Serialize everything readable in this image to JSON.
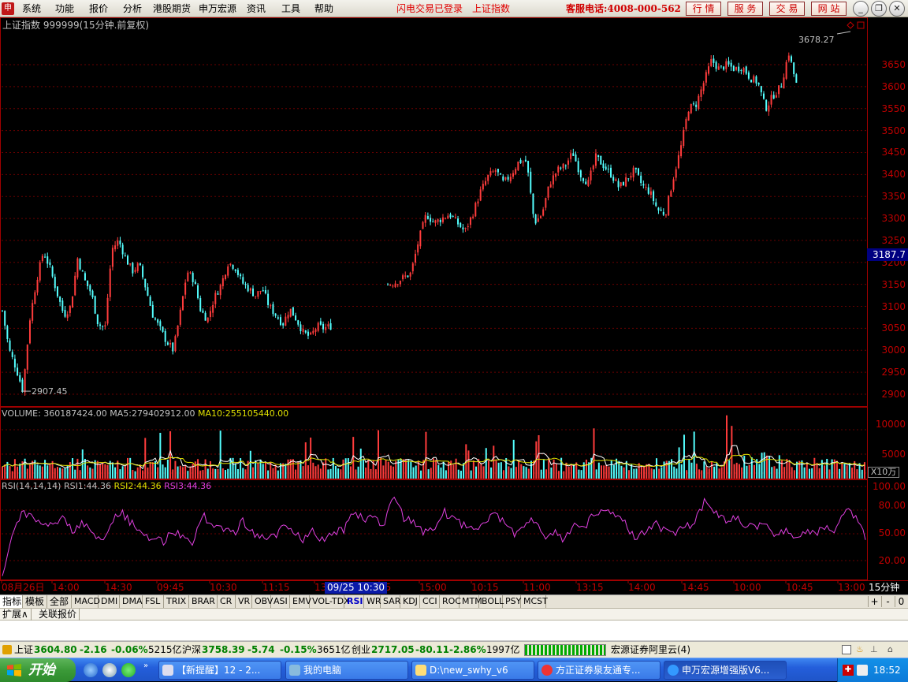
{
  "menu": {
    "items": [
      "系统",
      "功能",
      "报价",
      "分析",
      "港股期货",
      "申万宏源",
      "资讯",
      "工具",
      "帮助"
    ],
    "notice1": "闪电交易已登录",
    "notice2": "上证指数",
    "hotline": "客服电话:4008-000-562",
    "buttons": [
      "行 情",
      "服 务",
      "交 易",
      "网 站"
    ]
  },
  "price": {
    "title": "上证指数 999999(15分钟.前复权)",
    "y_ticks": [
      "3650",
      "3600",
      "3550",
      "3500",
      "3450",
      "3400",
      "3350",
      "3300",
      "3250",
      "3200",
      "3150",
      "3100",
      "3050",
      "3000",
      "2950",
      "2900"
    ],
    "high_label": "3678.27",
    "low_label": "2907.45",
    "current": "3187.7"
  },
  "volume": {
    "name": "VOLUME:",
    "value": "360187424.00",
    "ma5_label": "MA5:",
    "ma5": "279402912.00",
    "ma10_label": "MA10:",
    "ma10": "255105440.00",
    "y_ticks": [
      "10000",
      "5000"
    ],
    "multiplier": "X10万"
  },
  "rsi": {
    "name": "RSI(14,14,14)",
    "rsi1_label": "RSI1:",
    "rsi1": "44.36",
    "rsi2_label": "RSI2:",
    "rsi2": "44.36",
    "rsi3_label": "RSI3:",
    "rsi3": "44.36",
    "y_ticks": [
      "100.00",
      "80.00",
      "50.00",
      "20.00"
    ]
  },
  "xaxis": {
    "labels": [
      "08月26日",
      "14:00",
      "14:30",
      "09:45",
      "10:30",
      "11:15",
      "13",
      "15",
      "15:00",
      "10:15",
      "11:00",
      "13:15",
      "14:00",
      "14:45",
      "10:00",
      "10:45",
      "13:00"
    ],
    "cursor_date": "09/25 10:30",
    "period": "15分钟"
  },
  "tabs": [
    "指标",
    "模板",
    "全部",
    "MACD",
    "DMI",
    "DMA",
    "FSL",
    "TRIX",
    "BRAR",
    "CR",
    "VR",
    "OBV",
    "ASI",
    "EMV",
    "VOL-TDX",
    "RSI",
    "WR",
    "SAR",
    "KDJ",
    "CCI",
    "ROC",
    "MTM",
    "BOLL",
    "PSY",
    "MCST"
  ],
  "tab_controls": [
    "+",
    "-",
    "0"
  ],
  "subtabs": [
    "扩展∧",
    "关联报价"
  ],
  "status": {
    "sh_label": "上证",
    "sh_value": "3604.80",
    "sh_change": "-2.16",
    "sh_pct": "-0.06%",
    "sh_amount": "5215亿",
    "hs_label": "沪深",
    "hs_value": "3758.39",
    "hs_change": "-5.74",
    "hs_pct": "-0.15%",
    "hs_amount": "3651亿",
    "cy_label": "创业",
    "cy_value": "2717.05",
    "cy_change": "-80.11",
    "cy_pct": "-2.86%",
    "cy_amount": "1997亿",
    "server": "宏源证券阿里云(4)"
  },
  "taskbar": {
    "start": "开始",
    "tasks": [
      "【新提醒】12 - 2...",
      "我的电脑",
      "D:\\new_swhy_v6",
      "方正证券泉友通专...",
      "申万宏源增强版V6..."
    ],
    "clock": "18:52"
  },
  "chart_data": {
    "type": "candlestick",
    "title": "上证指数 999999(15分钟.前复权)",
    "period": "15分钟",
    "price_axis": [
      2900,
      3650
    ],
    "annotated_high": 3678.27,
    "annotated_low": 2907.45,
    "close_waypoints": [
      3090,
      3000,
      2960,
      2908,
      3070,
      3160,
      3225,
      3185,
      3130,
      3080,
      3100,
      3210,
      3160,
      3130,
      3060,
      3050,
      3230,
      3250,
      3210,
      3180,
      3195,
      3140,
      3080,
      3050,
      3020,
      3000,
      3085,
      3180,
      3160,
      3090,
      3070,
      3120,
      3150,
      3200,
      3190,
      3155,
      3140,
      3125,
      3140,
      3100,
      3080,
      3060,
      3095,
      3070,
      3040,
      3030,
      3055,
      3050,
      3055
    ],
    "close_waypoints_2": [
      3150,
      3155,
      3165,
      3175,
      3250,
      3310,
      3290,
      3300,
      3310,
      3290,
      3270,
      3310,
      3360,
      3395,
      3410,
      3380,
      3400,
      3430,
      3430,
      3290,
      3310,
      3380,
      3410,
      3420,
      3450,
      3400,
      3380,
      3440,
      3420,
      3400,
      3370,
      3390,
      3410,
      3375,
      3360,
      3320,
      3310,
      3390,
      3460,
      3550,
      3560,
      3610,
      3660,
      3640,
      3650,
      3640,
      3645,
      3620,
      3610,
      3550,
      3580,
      3600,
      3678,
      3605
    ],
    "volume_axis_x10w": [
      0,
      12000
    ],
    "volume_labeled": {
      "VOLUME": 360187424.0,
      "MA5": 279402912.0,
      "MA10": 255105440.0
    },
    "rsi_axis": [
      0,
      100
    ],
    "rsi_waypoints": [
      5,
      45,
      72,
      68,
      60,
      55,
      68,
      52,
      60,
      48,
      44,
      65,
      70,
      58,
      48,
      42,
      40,
      52,
      45,
      40,
      68,
      58,
      52,
      48,
      62,
      50,
      42,
      45,
      55,
      48,
      42,
      52,
      40,
      50,
      52,
      74,
      62,
      68,
      55,
      93,
      65,
      62,
      50,
      55,
      72,
      62,
      58,
      50,
      62,
      70,
      60,
      48,
      55,
      64,
      45,
      52,
      42,
      60,
      55,
      70,
      72,
      68,
      60,
      45,
      48,
      62,
      50,
      48,
      56,
      60,
      85,
      72,
      62,
      68,
      58,
      55,
      60,
      48,
      52,
      44,
      50,
      48,
      55,
      50,
      75,
      68,
      44
    ],
    "legend": [
      "RSI1",
      "RSI2",
      "RSI3"
    ]
  }
}
